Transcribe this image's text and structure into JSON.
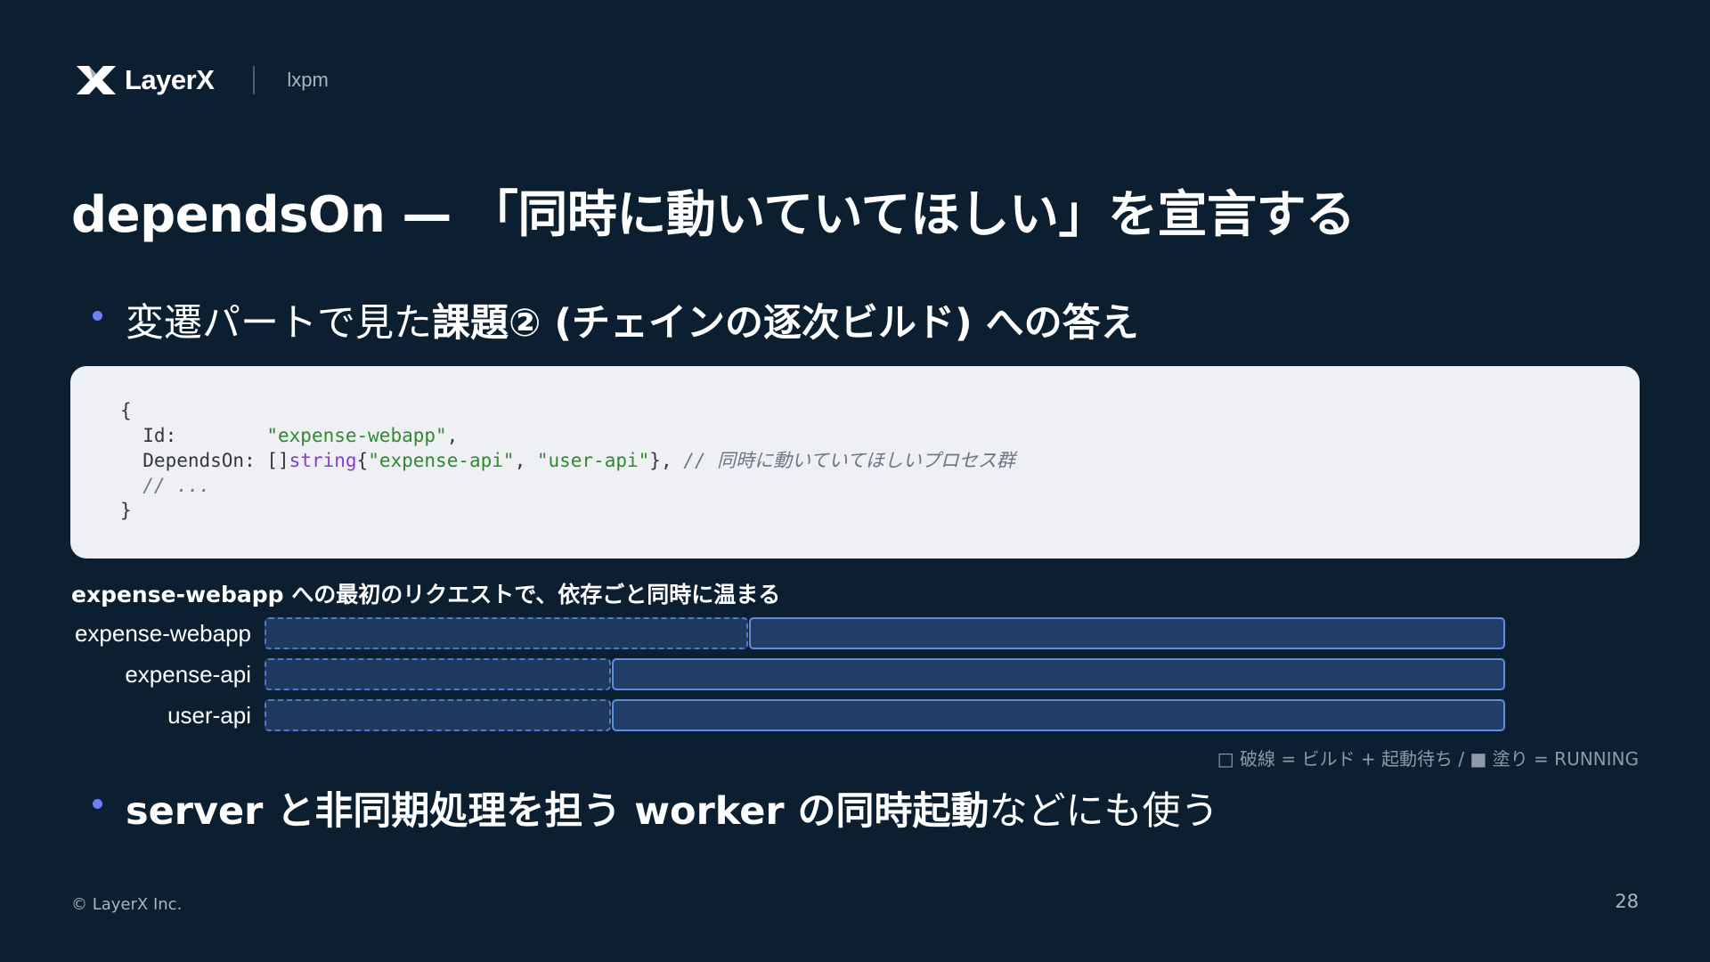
{
  "header": {
    "logo_text": "LayerX",
    "product": "lxpm"
  },
  "title": "dependsOn — 「同時に動いていてほしい」を宣言する",
  "bullet1": {
    "plain": "変遷パートで見た",
    "bold": "課題② (チェインの逐次ビルド) への答え"
  },
  "code": {
    "line1": "{",
    "line2_key": "  Id:        ",
    "line2_val": "\"expense-webapp\"",
    "line2_end": ",",
    "line3_key": "  DependsOn: ",
    "line3_bracket": "[]",
    "line3_type": "string",
    "line3_open": "{",
    "line3_val1": "\"expense-api\"",
    "line3_sep": ", ",
    "line3_val2": "\"user-api\"",
    "line3_close": "}, ",
    "line3_comment": "// 同時に動いていてほしいプロセス群",
    "line4": "  // ...",
    "line5": "}"
  },
  "timeline": {
    "heading": "expense-webapp への最初のリクエストで、依存ごと同時に温まる",
    "rows": [
      {
        "label": "expense-webapp",
        "build_end": 0.39
      },
      {
        "label": "expense-api",
        "build_end": 0.279
      },
      {
        "label": "user-api",
        "build_end": 0.279
      }
    ],
    "legend": "□ 破線 = ビルド + 起動待ち / ■ 塗り = RUNNING"
  },
  "bullet2": {
    "bold": "server と非同期処理を担う worker の同時起動",
    "plain": "などにも使う"
  },
  "footer": {
    "copyright": "© LayerX Inc.",
    "page": "28"
  },
  "colors": {
    "background": "#0c1f30",
    "accent_bullet": "#6c7ff5",
    "bar_border": "#5d8ee0",
    "code_bg": "#eff0f4"
  }
}
